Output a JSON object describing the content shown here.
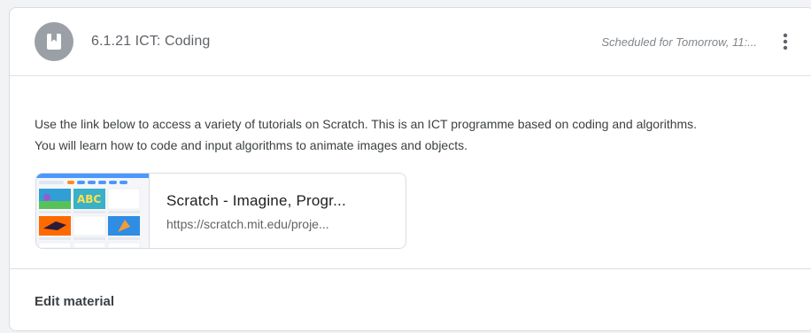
{
  "material": {
    "title": "6.1.21 ICT: Coding",
    "scheduled": "Scheduled for Tomorrow, 11:...",
    "icon": "book-icon",
    "menu_icon": "more-vert-icon",
    "description": [
      "Use the link below to access a variety of tutorials on Scratch. This is an ICT programme based on coding and algorithms.",
      "You will learn how to code and input algorithms to animate images and objects."
    ]
  },
  "attachment": {
    "title": "Scratch - Imagine, Progr...",
    "url": "https://scratch.mit.edu/proje...",
    "thumbnail": "scratch-tutorials-thumbnail"
  },
  "footer": {
    "edit_label": "Edit material"
  },
  "colors": {
    "avatar": "#9aa0a6",
    "scratch_header": "#4c97ff"
  }
}
